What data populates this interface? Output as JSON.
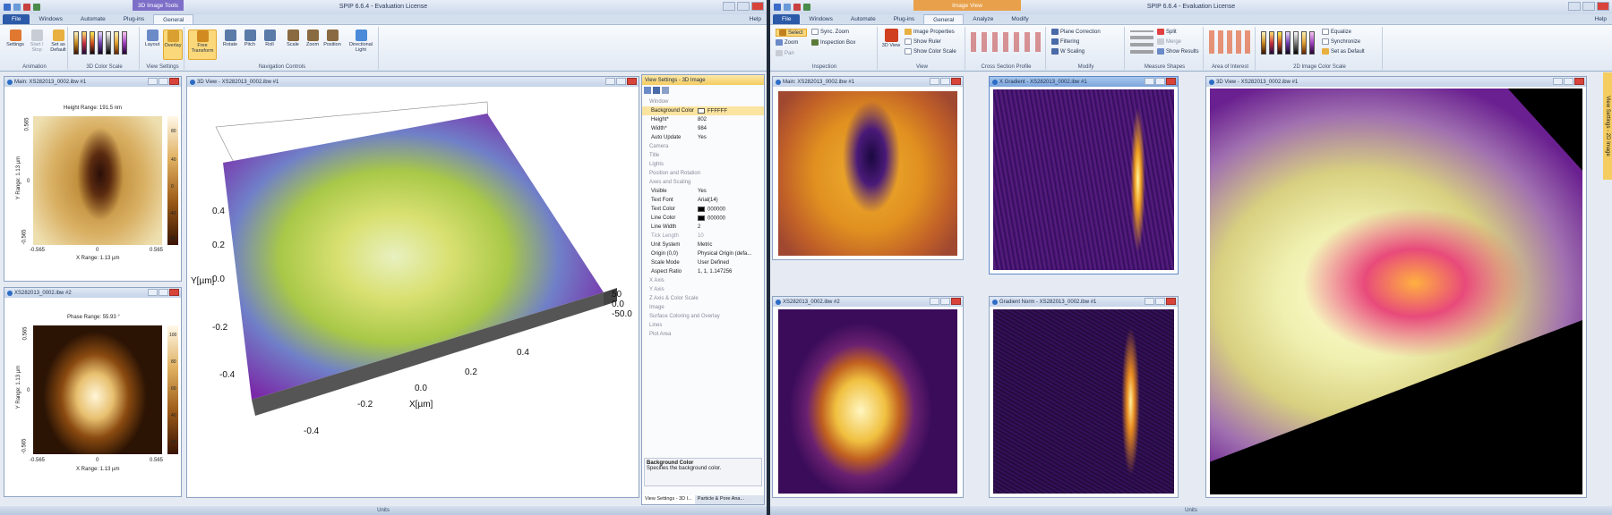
{
  "left": {
    "title": "SPIP 6.6.4 - Evaluation License",
    "context_tab": "3D Image Tools",
    "tabs": [
      "File",
      "Windows",
      "Automate",
      "Plug-ins",
      "General"
    ],
    "help": "Help",
    "ribbon": {
      "settings": "Settings",
      "start_stop": "Start / Stop",
      "set_default": "Set as Default",
      "group_animation": "Animation",
      "group_color": "3D Color Scale",
      "layout": "Layout",
      "overlay": "Overlay",
      "group_view": "View Settings",
      "free_transform": "Free Transform",
      "rotate": "Rotate",
      "pitch": "Pitch",
      "roll": "Roll",
      "scale": "Scale",
      "zoom": "Zoom",
      "position": "Position",
      "directional_light": "Directional Light",
      "group_nav": "Navigation Controls"
    },
    "main_win": {
      "title": "Main: XS282013_0002.ibw #1",
      "range_label": "Height Range:  191.5 nm",
      "y_label": "Y Range:  1.13 µm",
      "x_label": "X Range:  1.13 µm",
      "ticks_y": [
        "0.565",
        "0",
        "-0.565"
      ],
      "ticks_x": [
        "-0.565",
        "0",
        "0.565"
      ],
      "cbar_ticks": [
        "80",
        "40",
        "0",
        "-40",
        "-80"
      ]
    },
    "phase_win": {
      "title": "XS282013_0002.ibw #2",
      "range_label": "Phase Range:  55.93 °",
      "y_label": "Y Range:  1.13 µm",
      "x_label": "X Range:  1.13 µm",
      "ticks_y": [
        "0.565",
        "0",
        "-0.565"
      ],
      "ticks_x": [
        "-0.565",
        "0",
        "0.565"
      ],
      "cbar_ticks": [
        "100",
        "80",
        "60",
        "40",
        "20"
      ]
    },
    "view3d": {
      "title": "3D View - XS282013_0002.ibw #1",
      "y_axis": "Y[µm]",
      "x_axis": "X[µm]",
      "y_ticks": [
        "0.4",
        "0.2",
        "0.0",
        "-0.2",
        "-0.4"
      ],
      "x_ticks": [
        "-0.4",
        "-0.2",
        "0.0",
        "0.2",
        "0.4"
      ],
      "z_ticks": [
        "50",
        "0.0",
        "-50.0"
      ]
    },
    "panel": {
      "header": "View Settings - 3D Image",
      "rows": [
        {
          "k": "Window",
          "v": "",
          "cat": true
        },
        {
          "k": "Background Color",
          "v": "FFFFFF",
          "sel": true,
          "sw": "#ffffff"
        },
        {
          "k": "Height*",
          "v": "802"
        },
        {
          "k": "Width*",
          "v": "984"
        },
        {
          "k": "Auto Update",
          "v": "Yes"
        },
        {
          "k": "Camera",
          "v": "",
          "cat": true
        },
        {
          "k": "Title",
          "v": "",
          "cat": true
        },
        {
          "k": "Lights",
          "v": "",
          "cat": true
        },
        {
          "k": "Position and Rotation",
          "v": "",
          "cat": true
        },
        {
          "k": "Axes and Scaling",
          "v": "",
          "cat": true
        },
        {
          "k": "Visible",
          "v": "Yes"
        },
        {
          "k": "Text Font",
          "v": "Arial(14)"
        },
        {
          "k": "Text Color",
          "v": "000000",
          "sw": "#000000"
        },
        {
          "k": "Line Color",
          "v": "000000",
          "sw": "#000000"
        },
        {
          "k": "Line Width",
          "v": "2"
        },
        {
          "k": "Tick Length",
          "v": "10",
          "dim": true
        },
        {
          "k": "Unit System",
          "v": "Metric"
        },
        {
          "k": "Origin (0,0)",
          "v": "Physical Origin (defa..."
        },
        {
          "k": "Scale Mode",
          "v": "User Defined"
        },
        {
          "k": "Aspect Ratio",
          "v": "1, 1, 1.147256"
        },
        {
          "k": "X Axis",
          "v": "",
          "cat": true
        },
        {
          "k": "Y Axis",
          "v": "",
          "cat": true
        },
        {
          "k": "Z Axis & Color Scale",
          "v": "",
          "cat": true
        },
        {
          "k": "Image",
          "v": "",
          "cat": true
        },
        {
          "k": "Surface Coloring and Overlay",
          "v": "",
          "cat": true
        },
        {
          "k": "Lines",
          "v": "",
          "cat": true
        },
        {
          "k": "Plot Area",
          "v": "",
          "cat": true
        }
      ],
      "help_title": "Background Color",
      "help_text": "Specifies the background color.",
      "bottom_tabs": [
        "View Settings - 3D I...",
        "Particle & Pore Ana..."
      ]
    },
    "status": "Units"
  },
  "right": {
    "title": "SPIP 6.6.4 - Evaluation License",
    "context_tab": "Image View",
    "tabs": [
      "File",
      "Windows",
      "Automate",
      "Plug-ins",
      "General",
      "Analyze",
      "Modify"
    ],
    "help": "Help",
    "ribbon": {
      "select": "Select",
      "zoom": "Zoom",
      "pan": "Pan",
      "sync_zoom": "Sync. Zoom",
      "inspection_box": "Inspection Box",
      "group_inspection": "Inspection",
      "view3d": "3D View",
      "image_properties": "Image Properties",
      "show_ruler": "Show Ruler",
      "show_color_scale": "Show Color Scale",
      "group_view": "View",
      "group_cross": "Cross Section Profile",
      "plane_correction": "Plane Correction",
      "filtering": "Filtering",
      "w_scaling": "W Scaling",
      "group_modify": "Modify",
      "split": "Split",
      "merge": "Merge",
      "show_results": "Show Results",
      "group_measure": "Measure Shapes",
      "group_aoi": "Area of Interest",
      "equalize": "Equalize",
      "synchronize": "Synchronize",
      "set_default": "Set as Default",
      "group_color": "2D Image Color Scale"
    },
    "wins": {
      "main": "Main: XS282013_0002.ibw #1",
      "xgrad": "X Gradient - XS282013_0002.ibw #1",
      "img2": "XS282013_0002.ibw #2",
      "gnorm": "Gradient Norm - XS282013_0002.ibw #1",
      "view3d": "3D View - XS282013_0002.ibw #1"
    },
    "side_tab": "View Settings - 2D Image",
    "status": "Units"
  },
  "colors": {
    "accent": "#2c5aa8",
    "context_left": "#7d6fc8",
    "context_right": "#e8a04a",
    "selected": "#fbd87a"
  }
}
